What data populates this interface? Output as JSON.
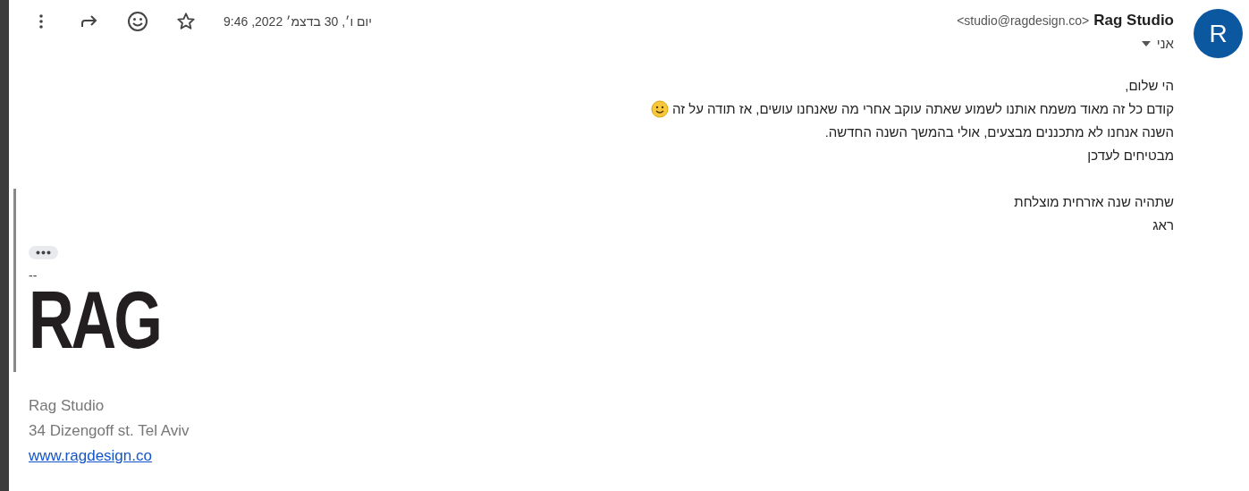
{
  "sender": {
    "name": "Rag Studio",
    "email": "<studio@ragdesign.co>",
    "avatar_letter": "R",
    "recipient": "אני"
  },
  "date": "יום ו׳, 30 בדצמ׳ 2022, 9:46",
  "starred": false,
  "paragraphs": [
    [
      "הי שלום,",
      "קודם כל זה מאוד משמח אותנו לשמוע שאתה עוקב אחרי מה שאנחנו עושים, אז תודה על זה",
      "השנה אנחנו לא מתכננים מבצעים, אולי בהמשך השנה החדשה.",
      "מבטיחים לעדכן"
    ],
    [
      "שתהיה שנה אזרחית מוצלחת",
      "ראג"
    ]
  ],
  "signature": {
    "separator": "--",
    "logo": "RAG",
    "lines": [
      "Rag Studio",
      "34 Dizengoff st. Tel Aviv"
    ],
    "link": "www.ragdesign.co"
  }
}
